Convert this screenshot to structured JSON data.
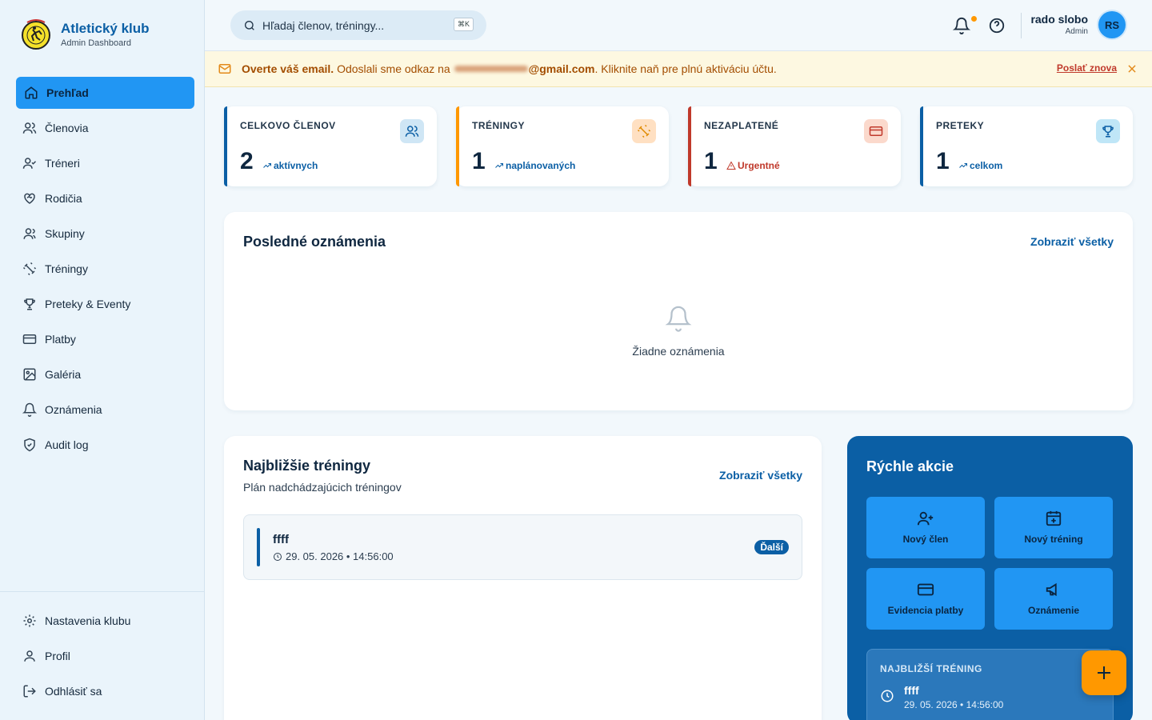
{
  "brand": {
    "title": "Atletický klub",
    "subtitle": "Admin Dashboard"
  },
  "nav": [
    {
      "label": "Prehľad",
      "icon": "home-icon",
      "active": true
    },
    {
      "label": "Členovia",
      "icon": "users-icon"
    },
    {
      "label": "Tréneri",
      "icon": "user-check-icon"
    },
    {
      "label": "Rodičia",
      "icon": "heart-handshake-icon"
    },
    {
      "label": "Skupiny",
      "icon": "users-group-icon"
    },
    {
      "label": "Tréningy",
      "icon": "dumbbell-icon"
    },
    {
      "label": "Preteky & Eventy",
      "icon": "trophy-icon"
    },
    {
      "label": "Platby",
      "icon": "credit-card-icon"
    },
    {
      "label": "Galéria",
      "icon": "image-icon"
    },
    {
      "label": "Oznámenia",
      "icon": "bell-icon"
    },
    {
      "label": "Audit log",
      "icon": "shield-icon"
    }
  ],
  "bottom_nav": [
    {
      "label": "Nastavenia klubu",
      "icon": "gear-icon"
    },
    {
      "label": "Profil",
      "icon": "user-icon"
    },
    {
      "label": "Odhlásiť sa",
      "icon": "logout-icon"
    }
  ],
  "search": {
    "placeholder": "Hľadaj členov, tréningy...",
    "shortcut": "⌘K"
  },
  "user": {
    "name": "rado slobo",
    "role": "Admin",
    "initials": "RS"
  },
  "banner": {
    "bold": "Overte váš email.",
    "text_before": " Odoslali sme odkaz na ",
    "email_domain": "@gmail.com",
    "text_after": ". Kliknite naň pre plnú aktiváciu účtu.",
    "resend": "Poslať znova"
  },
  "stats": [
    {
      "label": "CELKOVO ČLENOV",
      "value": "2",
      "sub": "aktívnych",
      "color": "#0b5fa5",
      "icon": "users-icon"
    },
    {
      "label": "TRÉNINGY",
      "value": "1",
      "sub": "naplánovaných",
      "color": "#ff9800",
      "icon": "dumbbell-icon"
    },
    {
      "label": "NEZAPLATENÉ",
      "value": "1",
      "sub": "Urgentné",
      "color": "#c0392b",
      "icon": "credit-card-icon"
    },
    {
      "label": "PRETEKY",
      "value": "1",
      "sub": "celkom",
      "color": "#0b5fa5",
      "icon": "trophy-icon"
    }
  ],
  "announcements": {
    "title": "Posledné oznámenia",
    "link": "Zobraziť všetky",
    "empty": "Žiadne oznámenia"
  },
  "trainings": {
    "title": "Najbližšie tréningy",
    "subtitle": "Plán nadchádzajúcich tréningov",
    "link": "Zobraziť všetky",
    "items": [
      {
        "name": "ffff",
        "date": "29. 05. 2026 • 14:56:00",
        "badge": "Ďalší"
      }
    ]
  },
  "quick": {
    "title": "Rýchle akcie",
    "actions": [
      {
        "label": "Nový člen",
        "icon": "user-plus-icon"
      },
      {
        "label": "Nový tréning",
        "icon": "calendar-plus-icon"
      },
      {
        "label": "Evidencia platby",
        "icon": "credit-card-icon"
      },
      {
        "label": "Oznámenie",
        "icon": "megaphone-icon"
      }
    ],
    "next_label": "NAJBLIŽŠÍ TRÉNING",
    "next_name": "ffff",
    "next_date": "29. 05. 2026 • 14:56:00"
  },
  "colors": {
    "accent": "#2196f3",
    "primary": "#0b5fa5",
    "orange": "#ff9800",
    "danger": "#c0392b"
  }
}
